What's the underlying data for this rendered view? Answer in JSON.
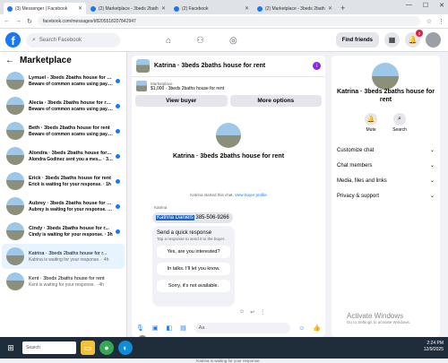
{
  "browser": {
    "tabs": [
      {
        "title": "(3) Messenger | Facebook",
        "active": true
      },
      {
        "title": "(2) Marketplace - 3beds 2bath",
        "active": false
      },
      {
        "title": "(2) Facebook",
        "active": false
      },
      {
        "title": "(2) Marketplace - 3beds 2bath",
        "active": false
      }
    ],
    "url": "facebook.com/messages/t/8205518207842947"
  },
  "fb": {
    "search_placeholder": "Search Facebook",
    "find_friends": "Find friends",
    "notif_count": "2"
  },
  "marketplace": {
    "title": "Marketplace",
    "conversations": [
      {
        "name": "Lymuel - 3beds 2baths house for rent",
        "preview": "Beware of common scams using pay... · 1m",
        "unread": true
      },
      {
        "name": "Alecia · 3beds 2baths house for rent",
        "preview": "Beware of common scams using pay... · 1m",
        "unread": true
      },
      {
        "name": "Beth · 3beds 2baths house for rent",
        "preview": "Beware of common scams using pay... · 1m",
        "unread": true
      },
      {
        "name": "Alondra · 3beds 2baths house for rent",
        "preview": "Alondra Godinez sent you a mes... · 34m",
        "unread": true
      },
      {
        "name": "Erick · 3beds 2baths house for rent",
        "preview": "Erick is waiting for your response. · 1h",
        "unread": true
      },
      {
        "name": "Aubrey · 3beds 2baths house for rent",
        "preview": "Aubrey is waiting for your response. · 2h",
        "unread": true
      },
      {
        "name": "Cindy · 3beds 2baths house for r...",
        "preview": "Cindy is waiting for your response. · 3h",
        "unread": true
      },
      {
        "name": "Katrina · 3beds 2baths house for r...",
        "preview": "Katrina is waiting for your response. · 4h",
        "unread": false
      },
      {
        "name": "Kent · 3beds 2baths house for rent",
        "preview": "Kent is waiting for your response. · 4h",
        "unread": false
      }
    ]
  },
  "chat": {
    "title": "Katrina · 3beds 2baths house for rent",
    "listing_source": "Marketplace",
    "listing_price": "$1,000 · 3beds 2baths house for rent",
    "view_buyer": "View buyer",
    "more_options": "More options",
    "center_name": "Katrina · 3beds 2baths house for rent",
    "started_text": "Katrina started this chat.",
    "view_profile": "View buyer profile",
    "sender": "Katrina",
    "msg_name": "Katrina Daniels",
    "msg_phone": "385-506-9266",
    "quick_title": "Send a quick response",
    "quick_sub": "Tap a response to send it to the buyer.",
    "quick_responses": [
      "Yes, are you interested?",
      "In talks. I'll let you know.",
      "Sorry, it's not available."
    ],
    "waiting": "Katrina is waiting for your response.",
    "input_placeholder": "Aa"
  },
  "info": {
    "name": "Katrina · 3beds 2baths house for rent",
    "mute": "Mute",
    "search": "Search",
    "menu": [
      "Customize chat",
      "Chat members",
      "Media, files and links",
      "Privacy & support"
    ]
  },
  "os": {
    "watermark_title": "Activate Windows",
    "watermark_sub": "Go to Settings to activate Windows.",
    "search": "Search",
    "time": "2:24 PM",
    "date": "12/9/2025"
  }
}
